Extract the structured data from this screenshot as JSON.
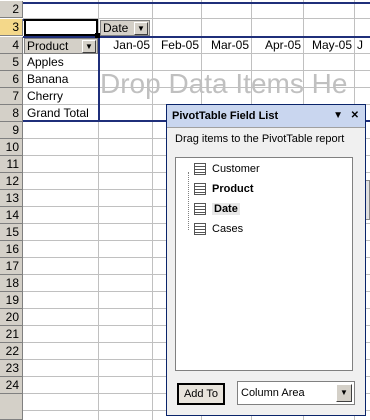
{
  "sheet": {
    "row_numbers": [
      "2",
      "3",
      "4",
      "5",
      "6",
      "7",
      "8",
      "9",
      "10",
      "11",
      "12",
      "13",
      "14",
      "15",
      "16",
      "17",
      "18",
      "19",
      "20",
      "21",
      "22",
      "23",
      "24"
    ],
    "page_field": {
      "label": "Date",
      "dropdown": "▼"
    },
    "row_field": {
      "label": "Product",
      "dropdown": "▼"
    },
    "row_items": [
      "Apples",
      "Banana",
      "Cherry",
      "Grand Total"
    ],
    "months": [
      "Jan-05",
      "Feb-05",
      "Mar-05",
      "Apr-05",
      "May-05",
      "J"
    ],
    "drop_hint": "Drop Data Items He"
  },
  "field_list": {
    "title": "PivotTable Field List",
    "title_dropdown": "▼",
    "close": "✕",
    "instructions": "Drag items to the PivotTable report",
    "fields": [
      {
        "label": "Customer",
        "bold": false
      },
      {
        "label": "Product",
        "bold": true
      },
      {
        "label": "Date",
        "bold": true
      },
      {
        "label": "Cases",
        "bold": false
      }
    ],
    "add_button": "Add To",
    "area_select": "Column Area",
    "area_select_arrow": "▼"
  },
  "colors": {
    "pivot_border": "#1f2f7a",
    "header_bg": "#d4d0c8",
    "title_bg": "#c9d6ef"
  }
}
